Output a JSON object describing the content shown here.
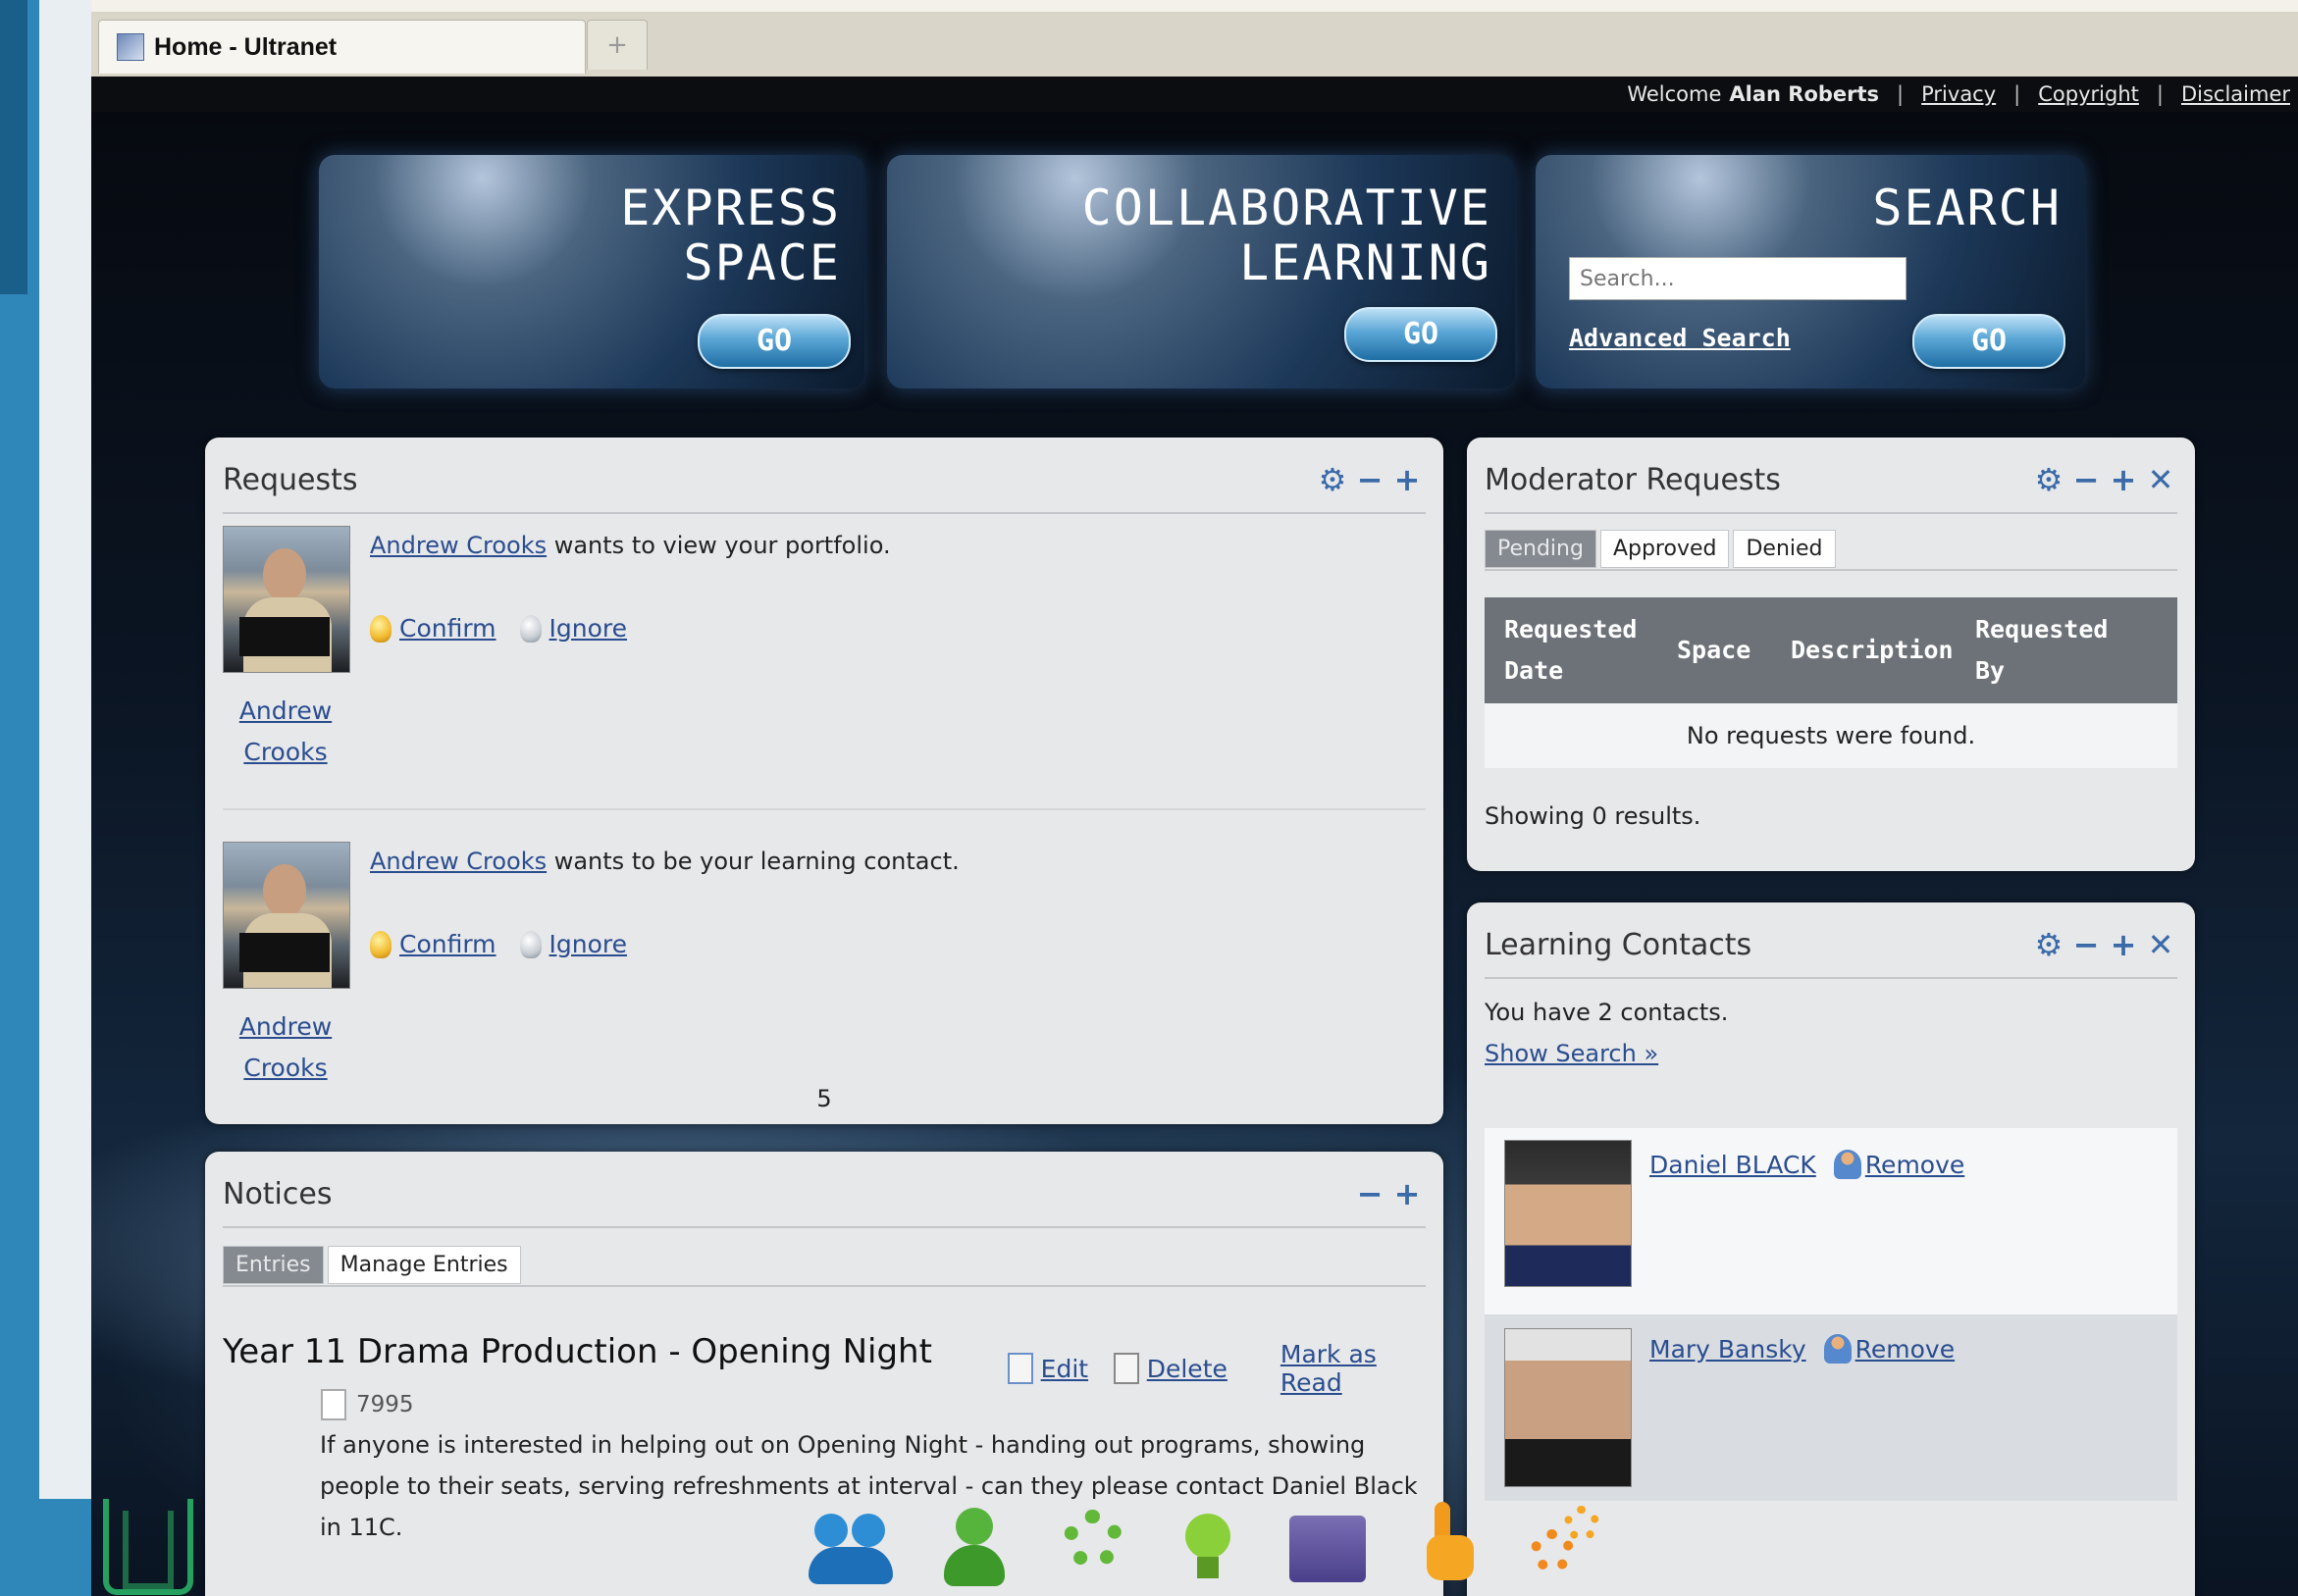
{
  "browser": {
    "tab_title": "Home - Ultranet",
    "new_tab_symbol": "+"
  },
  "topbar": {
    "welcome": "Welcome",
    "user_name": "Alan Roberts",
    "links": [
      "Privacy",
      "Copyright",
      "Disclaimer"
    ],
    "separator": "|"
  },
  "banners": {
    "express": {
      "title": "EXPRESS\nSPACE",
      "go": "GO"
    },
    "collab": {
      "title": "COLLABORATIVE\nLEARNING",
      "go": "GO"
    },
    "search": {
      "title": "SEARCH",
      "placeholder": "Search...",
      "advanced": "Advanced Search",
      "go": "GO"
    }
  },
  "requests": {
    "title": "Requests",
    "items": [
      {
        "person": "Andrew Crooks",
        "text": " wants to view your portfolio.",
        "confirm": "Confirm",
        "ignore": "Ignore",
        "photo_name_1": "Andrew",
        "photo_name_2": "Crooks"
      },
      {
        "person": "Andrew Crooks",
        "text": " wants to be your learning contact.",
        "confirm": "Confirm",
        "ignore": "Ignore",
        "photo_name_1": "Andrew",
        "photo_name_2": "Crooks"
      }
    ],
    "page_number": "5"
  },
  "moderator": {
    "title": "Moderator Requests",
    "tabs": [
      "Pending",
      "Approved",
      "Denied"
    ],
    "columns": [
      "Requested Date",
      "Space",
      "Description",
      "Requested By"
    ],
    "empty_text": "No requests were found.",
    "showing": "Showing 0 results."
  },
  "notices": {
    "title": "Notices",
    "tabs": [
      "Entries",
      "Manage Entries"
    ],
    "entry": {
      "title": "Year 11 Drama Production - Opening Night",
      "edit": "Edit",
      "delete": "Delete",
      "mark_read": "Mark as Read",
      "id": "7995",
      "body": "If anyone is interested in helping out on Opening Night - handing out programs, showing people to their seats, serving refreshments at interval - can they please contact Daniel Black in 11C."
    }
  },
  "contacts": {
    "title": "Learning Contacts",
    "summary": "You have 2 contacts.",
    "show_search": "Show Search »",
    "items": [
      {
        "name": "Daniel BLACK",
        "remove": "Remove"
      },
      {
        "name": "Mary Bansky",
        "remove": "Remove"
      }
    ]
  },
  "controls": {
    "gear": "⚙",
    "minus": "−",
    "plus": "+",
    "close": "✕"
  },
  "dock": [
    "people-icon",
    "person-icon",
    "flower-icon",
    "lightbulb-icon",
    "folder-icon",
    "hand-icon",
    "gears-icon"
  ]
}
